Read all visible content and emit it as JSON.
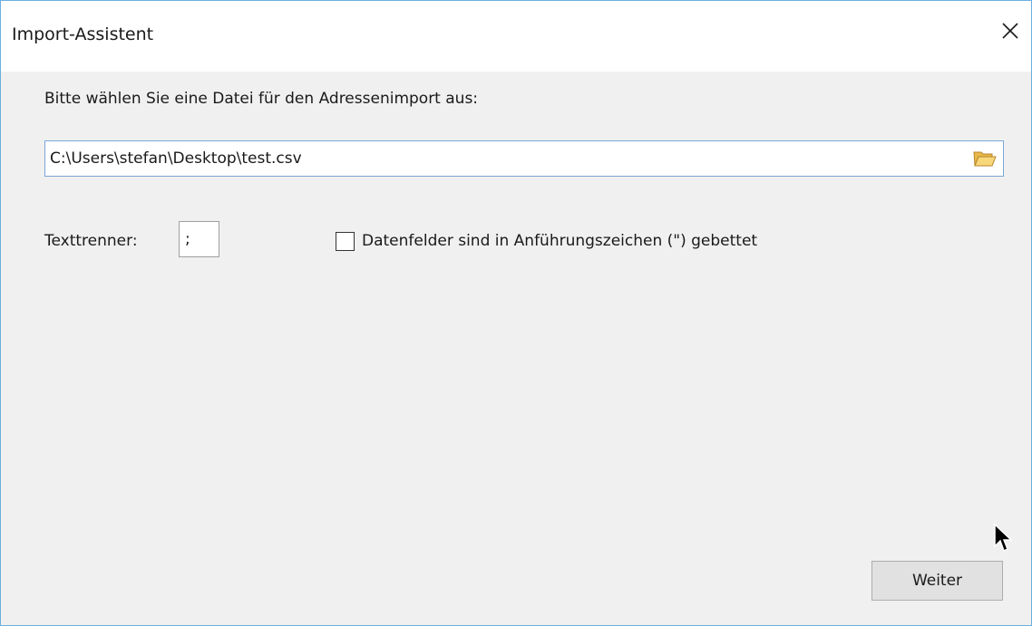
{
  "window": {
    "title": "Import-Assistent",
    "close_icon": "close-icon"
  },
  "dialog": {
    "prompt": "Bitte wählen Sie eine Datei für den Adressenimport aus:",
    "file_path": "C:\\Users\\stefan\\Desktop\\test.csv",
    "browse_icon": "folder-open-icon",
    "separator_label": "Texttrenner:",
    "separator_value": ";",
    "quotes_checkbox_label": "Datenfelder sind in Anführungszeichen (\") gebettet",
    "quotes_checkbox_checked": false,
    "next_button": "Weiter"
  },
  "colors": {
    "window_border": "#6ab0de",
    "background": "#f0f0f0",
    "input_focus_border": "#7aa7d6",
    "button_face": "#e1e1e1"
  }
}
